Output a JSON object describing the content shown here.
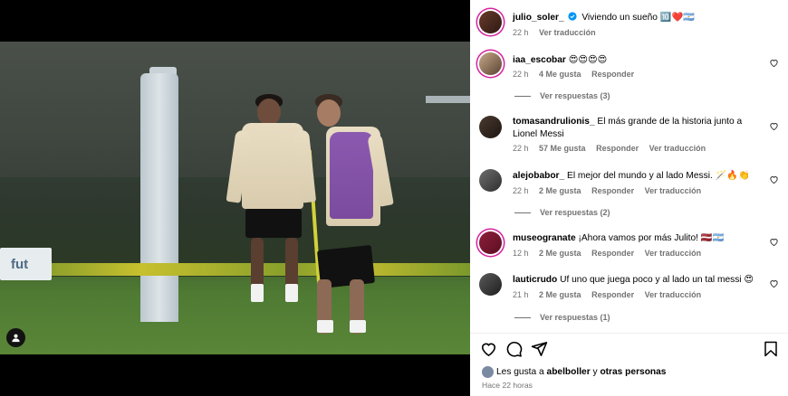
{
  "caption": {
    "username": "julio_soler_",
    "text": "Viviendo un sueño 🔟❤️🇦🇷",
    "time": "22 h",
    "translate": "Ver traducción"
  },
  "comments": [
    {
      "username": "iaa_escobar",
      "text": "😍😍😍😍",
      "time": "22 h",
      "likes": "4 Me gusta",
      "reply": "Responder",
      "translate": "",
      "replies": "Ver respuestas (3)"
    },
    {
      "username": "tomasandrulionis_",
      "text": "El más grande de la historia junto a Lionel Messi",
      "time": "22 h",
      "likes": "57 Me gusta",
      "reply": "Responder",
      "translate": "Ver traducción",
      "replies": ""
    },
    {
      "username": "alejobabor_",
      "text": "El mejor del mundo y al lado Messi. 🪄🔥👏",
      "time": "22 h",
      "likes": "2 Me gusta",
      "reply": "Responder",
      "translate": "Ver traducción",
      "replies": "Ver respuestas (2)"
    },
    {
      "username": "museogranate",
      "text": "¡Ahora vamos por más Julito! 🇱🇻🇦🇷",
      "time": "12 h",
      "likes": "2 Me gusta",
      "reply": "Responder",
      "translate": "Ver traducción",
      "replies": ""
    },
    {
      "username": "lauticrudo",
      "text": "Uf uno que juega poco y al lado un tal messi 😍",
      "time": "21 h",
      "likes": "2 Me gusta",
      "reply": "Responder",
      "translate": "Ver traducción",
      "replies": "Ver respuestas (1)"
    }
  ],
  "footer": {
    "liked_prefix": "Les gusta a",
    "liked_user": "abelboller",
    "liked_and": "y",
    "liked_others": "otras personas",
    "time_ago": "Hace 22 horas"
  },
  "photo": {
    "sign_text": "fut"
  },
  "colors": {
    "secondary_text": "#737373",
    "story_ring": "#d6249f",
    "verified": "#0095f6",
    "photo_bg": "#000000"
  },
  "icons": {
    "like": "heart-icon",
    "comment": "comment-bubble-icon",
    "share": "paper-plane-icon",
    "save": "bookmark-icon",
    "tag": "user-tag-icon",
    "verified": "verified-badge-icon"
  }
}
